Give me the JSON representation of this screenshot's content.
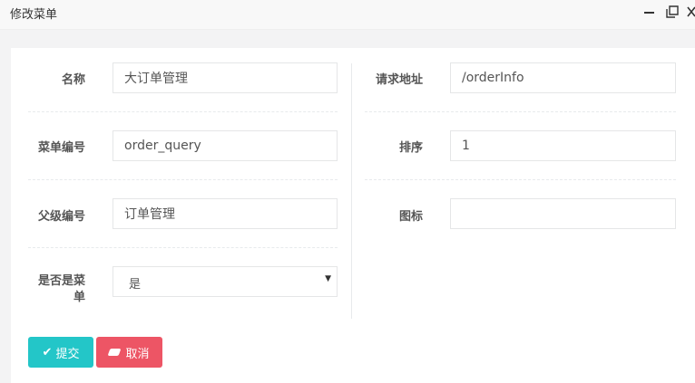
{
  "window": {
    "title": "修改菜单",
    "controls": {
      "minimize_icon": "minimize-icon",
      "maximize_icon": "maximize-icon",
      "close_icon": "close-icon"
    }
  },
  "form": {
    "name_label": "名称",
    "name_value": "大订单管理",
    "menu_code_label": "菜单编号",
    "menu_code_value": "order_query",
    "parent_code_label": "父级编号",
    "parent_code_value": "订单管理",
    "is_menu_label": "是否是菜单",
    "is_menu_value": "是",
    "url_label": "请求地址",
    "url_value": "/orderInfo",
    "sort_label": "排序",
    "sort_value": "1",
    "icon_label": "图标",
    "icon_value": ""
  },
  "actions": {
    "submit_label": "提交",
    "cancel_label": "取消"
  },
  "colors": {
    "submit": "#23c6c8",
    "cancel": "#ed5565"
  }
}
